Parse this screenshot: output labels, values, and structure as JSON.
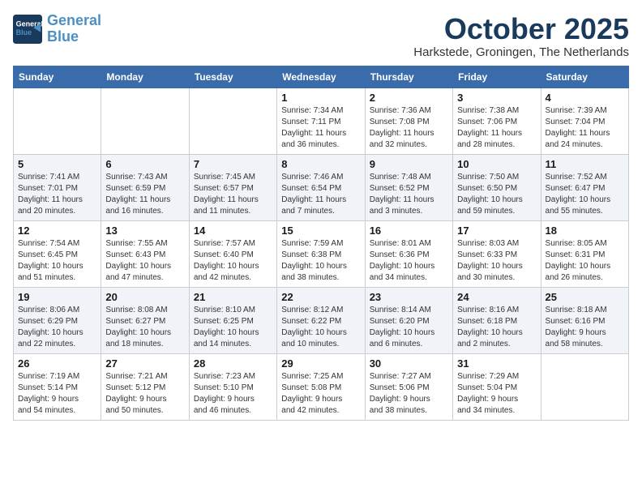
{
  "header": {
    "logo_line1": "General",
    "logo_line2": "Blue",
    "month": "October 2025",
    "location": "Harkstede, Groningen, The Netherlands"
  },
  "weekdays": [
    "Sunday",
    "Monday",
    "Tuesday",
    "Wednesday",
    "Thursday",
    "Friday",
    "Saturday"
  ],
  "weeks": [
    [
      {
        "day": "",
        "info": ""
      },
      {
        "day": "",
        "info": ""
      },
      {
        "day": "",
        "info": ""
      },
      {
        "day": "1",
        "info": "Sunrise: 7:34 AM\nSunset: 7:11 PM\nDaylight: 11 hours\nand 36 minutes."
      },
      {
        "day": "2",
        "info": "Sunrise: 7:36 AM\nSunset: 7:08 PM\nDaylight: 11 hours\nand 32 minutes."
      },
      {
        "day": "3",
        "info": "Sunrise: 7:38 AM\nSunset: 7:06 PM\nDaylight: 11 hours\nand 28 minutes."
      },
      {
        "day": "4",
        "info": "Sunrise: 7:39 AM\nSunset: 7:04 PM\nDaylight: 11 hours\nand 24 minutes."
      }
    ],
    [
      {
        "day": "5",
        "info": "Sunrise: 7:41 AM\nSunset: 7:01 PM\nDaylight: 11 hours\nand 20 minutes."
      },
      {
        "day": "6",
        "info": "Sunrise: 7:43 AM\nSunset: 6:59 PM\nDaylight: 11 hours\nand 16 minutes."
      },
      {
        "day": "7",
        "info": "Sunrise: 7:45 AM\nSunset: 6:57 PM\nDaylight: 11 hours\nand 11 minutes."
      },
      {
        "day": "8",
        "info": "Sunrise: 7:46 AM\nSunset: 6:54 PM\nDaylight: 11 hours\nand 7 minutes."
      },
      {
        "day": "9",
        "info": "Sunrise: 7:48 AM\nSunset: 6:52 PM\nDaylight: 11 hours\nand 3 minutes."
      },
      {
        "day": "10",
        "info": "Sunrise: 7:50 AM\nSunset: 6:50 PM\nDaylight: 10 hours\nand 59 minutes."
      },
      {
        "day": "11",
        "info": "Sunrise: 7:52 AM\nSunset: 6:47 PM\nDaylight: 10 hours\nand 55 minutes."
      }
    ],
    [
      {
        "day": "12",
        "info": "Sunrise: 7:54 AM\nSunset: 6:45 PM\nDaylight: 10 hours\nand 51 minutes."
      },
      {
        "day": "13",
        "info": "Sunrise: 7:55 AM\nSunset: 6:43 PM\nDaylight: 10 hours\nand 47 minutes."
      },
      {
        "day": "14",
        "info": "Sunrise: 7:57 AM\nSunset: 6:40 PM\nDaylight: 10 hours\nand 42 minutes."
      },
      {
        "day": "15",
        "info": "Sunrise: 7:59 AM\nSunset: 6:38 PM\nDaylight: 10 hours\nand 38 minutes."
      },
      {
        "day": "16",
        "info": "Sunrise: 8:01 AM\nSunset: 6:36 PM\nDaylight: 10 hours\nand 34 minutes."
      },
      {
        "day": "17",
        "info": "Sunrise: 8:03 AM\nSunset: 6:33 PM\nDaylight: 10 hours\nand 30 minutes."
      },
      {
        "day": "18",
        "info": "Sunrise: 8:05 AM\nSunset: 6:31 PM\nDaylight: 10 hours\nand 26 minutes."
      }
    ],
    [
      {
        "day": "19",
        "info": "Sunrise: 8:06 AM\nSunset: 6:29 PM\nDaylight: 10 hours\nand 22 minutes."
      },
      {
        "day": "20",
        "info": "Sunrise: 8:08 AM\nSunset: 6:27 PM\nDaylight: 10 hours\nand 18 minutes."
      },
      {
        "day": "21",
        "info": "Sunrise: 8:10 AM\nSunset: 6:25 PM\nDaylight: 10 hours\nand 14 minutes."
      },
      {
        "day": "22",
        "info": "Sunrise: 8:12 AM\nSunset: 6:22 PM\nDaylight: 10 hours\nand 10 minutes."
      },
      {
        "day": "23",
        "info": "Sunrise: 8:14 AM\nSunset: 6:20 PM\nDaylight: 10 hours\nand 6 minutes."
      },
      {
        "day": "24",
        "info": "Sunrise: 8:16 AM\nSunset: 6:18 PM\nDaylight: 10 hours\nand 2 minutes."
      },
      {
        "day": "25",
        "info": "Sunrise: 8:18 AM\nSunset: 6:16 PM\nDaylight: 9 hours\nand 58 minutes."
      }
    ],
    [
      {
        "day": "26",
        "info": "Sunrise: 7:19 AM\nSunset: 5:14 PM\nDaylight: 9 hours\nand 54 minutes."
      },
      {
        "day": "27",
        "info": "Sunrise: 7:21 AM\nSunset: 5:12 PM\nDaylight: 9 hours\nand 50 minutes."
      },
      {
        "day": "28",
        "info": "Sunrise: 7:23 AM\nSunset: 5:10 PM\nDaylight: 9 hours\nand 46 minutes."
      },
      {
        "day": "29",
        "info": "Sunrise: 7:25 AM\nSunset: 5:08 PM\nDaylight: 9 hours\nand 42 minutes."
      },
      {
        "day": "30",
        "info": "Sunrise: 7:27 AM\nSunset: 5:06 PM\nDaylight: 9 hours\nand 38 minutes."
      },
      {
        "day": "31",
        "info": "Sunrise: 7:29 AM\nSunset: 5:04 PM\nDaylight: 9 hours\nand 34 minutes."
      },
      {
        "day": "",
        "info": ""
      }
    ]
  ]
}
